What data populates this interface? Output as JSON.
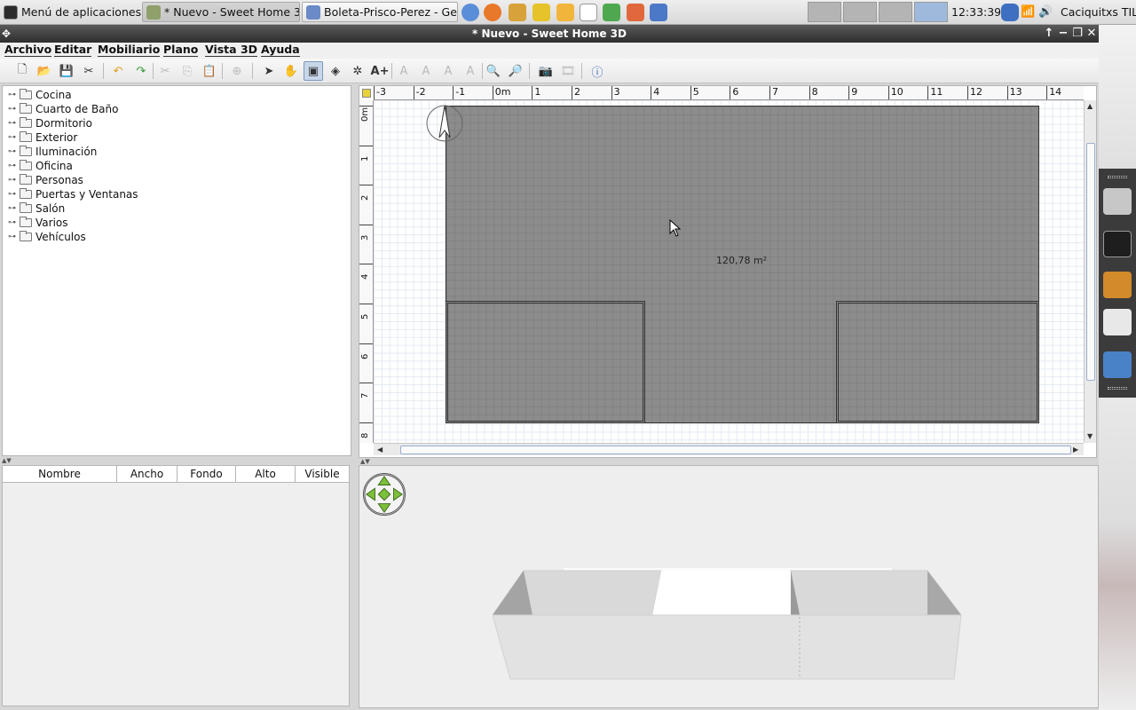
{
  "taskbar": {
    "app_menu": "Menú de aplicaciones",
    "tasks": [
      {
        "label": "* Nuevo - Sweet Home 3D",
        "active": true
      },
      {
        "label": "Boleta-Prisco-Perez - Ge..."
      }
    ],
    "clock": "12:33:39",
    "user": "Caciquitxs TIL"
  },
  "window": {
    "title": "* Nuevo - Sweet Home 3D",
    "controls": [
      "↑",
      "−",
      "❐",
      "✕"
    ]
  },
  "menu": [
    "Archivo",
    "Editar",
    "Mobiliario",
    "Plano",
    "Vista 3D",
    "Ayuda"
  ],
  "toolbar": {
    "tools": [
      "new-file",
      "open",
      "save",
      "cut-tool",
      "undo",
      "redo",
      "cut",
      "copy",
      "paste",
      "add-furniture",
      "select-mode",
      "pan-mode",
      "create-rooms",
      "create-dimensions",
      "create-walls",
      "add-text",
      "text-style-1",
      "text-style-2",
      "text-style-3",
      "text-style-4",
      "zoom-in",
      "zoom-out",
      "create-photo",
      "create-video",
      "help"
    ]
  },
  "catalog": {
    "categories": [
      "Cocina",
      "Cuarto de Baño",
      "Dormitorio",
      "Exterior",
      "Iluminación",
      "Oficina",
      "Personas",
      "Puertas y Ventanas",
      "Salón",
      "Varios",
      "Vehículos"
    ]
  },
  "furniture_table": {
    "columns": [
      "Nombre",
      "Ancho",
      "Fondo",
      "Alto",
      "Visible"
    ]
  },
  "plan": {
    "ruler_x": [
      "-3",
      "-2",
      "-1",
      "0m",
      "1",
      "2",
      "3",
      "4",
      "5",
      "6",
      "7",
      "8",
      "9",
      "10",
      "11",
      "12",
      "13",
      "14",
      "1"
    ],
    "ruler_y": [
      "0m",
      "1",
      "2",
      "3",
      "4",
      "5",
      "6",
      "7",
      "8"
    ],
    "area_label": "120,78 m²"
  },
  "colors": {
    "room_fill": "#8c8c8c",
    "title_bar": "#3c3c3c",
    "grid": "#e5eaf2"
  }
}
